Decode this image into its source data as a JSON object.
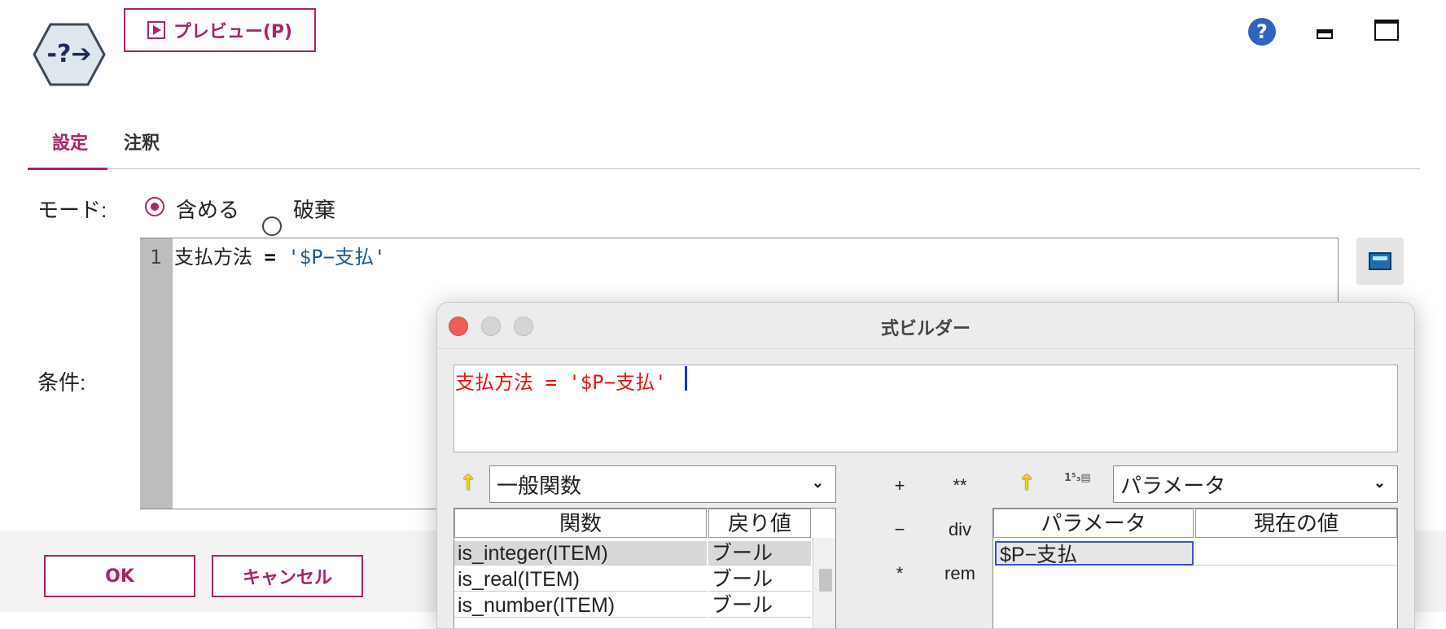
{
  "toolbar": {
    "preview_label": "プレビュー(P)"
  },
  "tabs": [
    {
      "label": "設定",
      "active": true
    },
    {
      "label": "注釈",
      "active": false
    }
  ],
  "mode": {
    "label": "モード:",
    "options": [
      {
        "label": "含める",
        "selected": true
      },
      {
        "label": "破棄",
        "selected": false
      }
    ]
  },
  "condition": {
    "label": "条件:",
    "line_number": "1",
    "field": "支払方法",
    "operator": "=",
    "value": "'$P−支払'"
  },
  "buttons": {
    "ok": "OK",
    "cancel": "キャンセル"
  },
  "dialog": {
    "title": "式ビルダー",
    "expression": "支払方法 = '$P−支払'",
    "function_group": "一般関数",
    "function_columns": [
      "関数",
      "戻り値"
    ],
    "functions": [
      {
        "name": "is_integer(ITEM)",
        "return": "ブール",
        "selected": true
      },
      {
        "name": "is_real(ITEM)",
        "return": "ブール",
        "selected": false
      },
      {
        "name": "is_number(ITEM)",
        "return": "ブール",
        "selected": false
      }
    ],
    "operators": [
      "+",
      "**",
      "−",
      "div",
      "*",
      "rem"
    ],
    "param_group": "パラメータ",
    "param_columns": [
      "パラメータ",
      "現在の値"
    ],
    "params": [
      {
        "name": "$P−支払",
        "value": ""
      }
    ]
  },
  "colors": {
    "accent": "#a8246b",
    "expression_text": "#e11111"
  }
}
